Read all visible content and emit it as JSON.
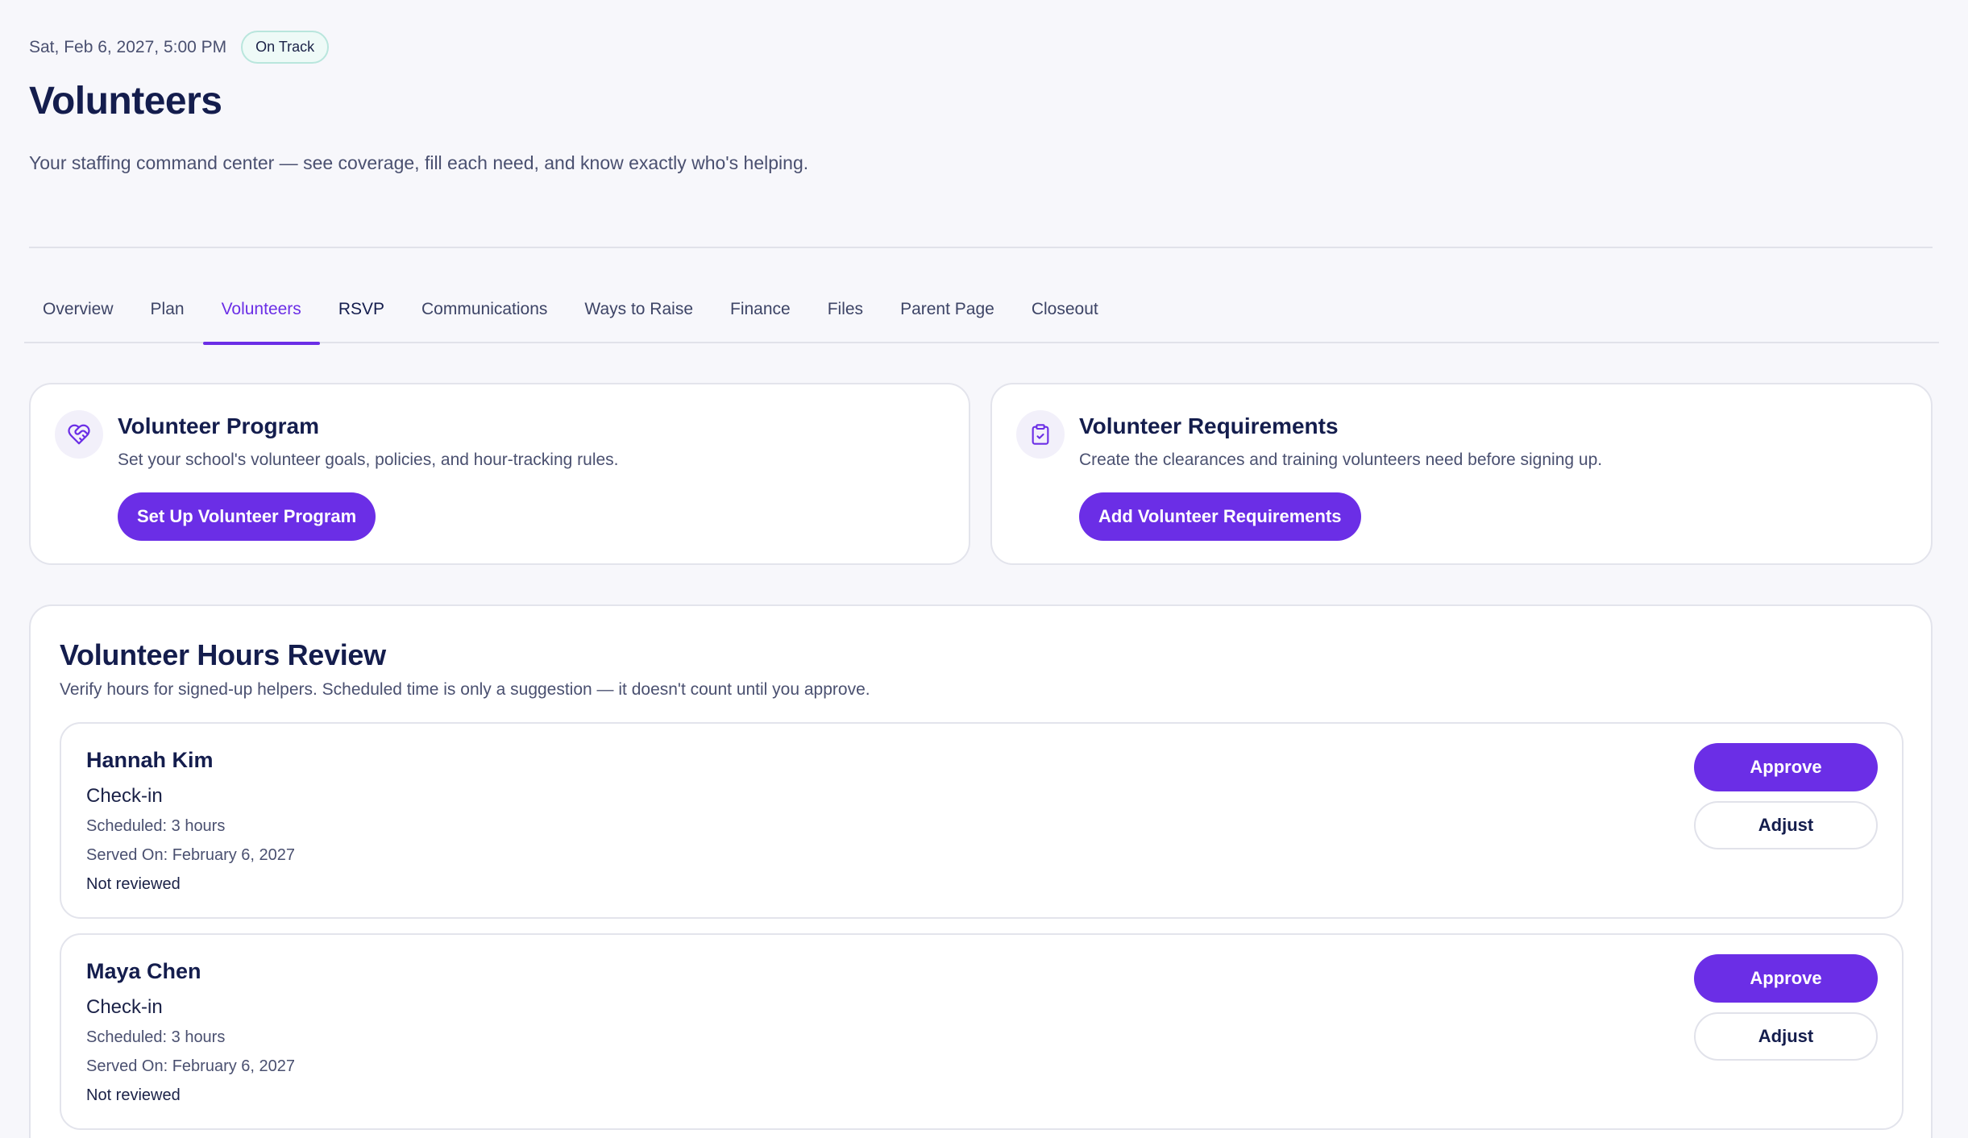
{
  "header": {
    "datetime": "Sat, Feb 6, 2027, 5:00 PM",
    "status": "On Track",
    "title": "Volunteers",
    "subtitle": "Your staffing command center — see coverage, fill each need, and know exactly who's helping."
  },
  "tabs": [
    {
      "label": "Overview"
    },
    {
      "label": "Plan"
    },
    {
      "label": "Volunteers",
      "active": true
    },
    {
      "label": "RSVP"
    },
    {
      "label": "Communications"
    },
    {
      "label": "Ways to Raise"
    },
    {
      "label": "Finance"
    },
    {
      "label": "Files"
    },
    {
      "label": "Parent Page"
    },
    {
      "label": "Closeout"
    }
  ],
  "program_card": {
    "icon": "heart-handshake-icon",
    "title": "Volunteer Program",
    "description": "Set your school's volunteer goals, policies, and hour-tracking rules.",
    "button": "Set Up Volunteer Program"
  },
  "requirements_card": {
    "icon": "clipboard-check-icon",
    "title": "Volunteer Requirements",
    "description": "Create the clearances and training volunteers need before signing up.",
    "button": "Add Volunteer Requirements"
  },
  "hours_review": {
    "title": "Volunteer Hours Review",
    "description": "Verify hours for signed-up helpers. Scheduled time is only a suggestion — it doesn't count until you approve.",
    "approve_label": "Approve",
    "adjust_label": "Adjust",
    "entries": [
      {
        "name": "Hannah Kim",
        "role": "Check-in",
        "scheduled": "Scheduled: 3 hours",
        "served": "Served On: February 6, 2027",
        "status": "Not reviewed"
      },
      {
        "name": "Maya Chen",
        "role": "Check-in",
        "scheduled": "Scheduled: 3 hours",
        "served": "Served On: February 6, 2027",
        "status": "Not reviewed"
      }
    ]
  },
  "colors": {
    "accent": "#6b2ee6",
    "title": "#141d4d",
    "badge_border": "#b9e6dd",
    "background": "#f7f7fb"
  }
}
